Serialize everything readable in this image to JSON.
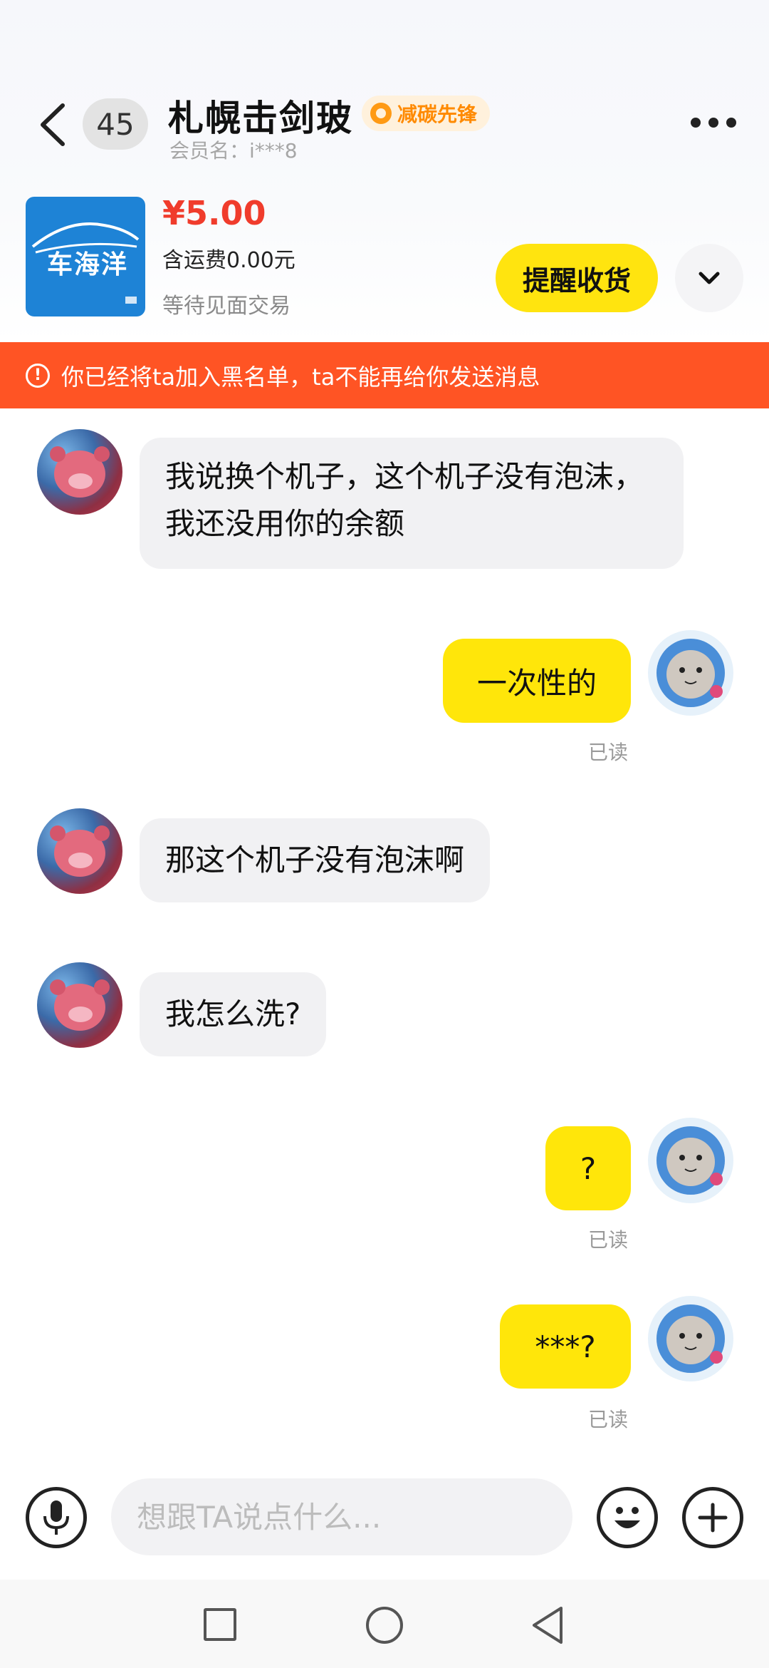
{
  "header": {
    "unread_count": "45",
    "title": "札幌击剑玻",
    "badge": "减碳先锋",
    "member": "会员名：i***8"
  },
  "product": {
    "brand_text": "车海洋",
    "price": "¥5.00",
    "shipping": "含运费0.00元",
    "status": "等待见面交易",
    "remind_button": "提醒收货"
  },
  "warning": {
    "icon": "!",
    "text": "你已经将ta加入黑名单，ta不能再给你发送消息"
  },
  "messages": [
    {
      "side": "other",
      "text": "我说换个机子，这个机子没有泡沫，我还没用你的余额"
    },
    {
      "side": "self",
      "text": "一次性的",
      "read": "已读"
    },
    {
      "side": "other",
      "text": "那这个机子没有泡沫啊"
    },
    {
      "side": "other",
      "text": "我怎么洗?"
    },
    {
      "side": "self",
      "text": "?",
      "read": "已读"
    },
    {
      "side": "self",
      "text": "***?",
      "read": "已读"
    }
  ],
  "input": {
    "placeholder": "想跟TA说点什么..."
  },
  "colors": {
    "accent_yellow": "#ffe60a",
    "warning_bg": "#ff5424",
    "price_red": "#f03c2c",
    "badge_orange": "#ff8a00"
  }
}
